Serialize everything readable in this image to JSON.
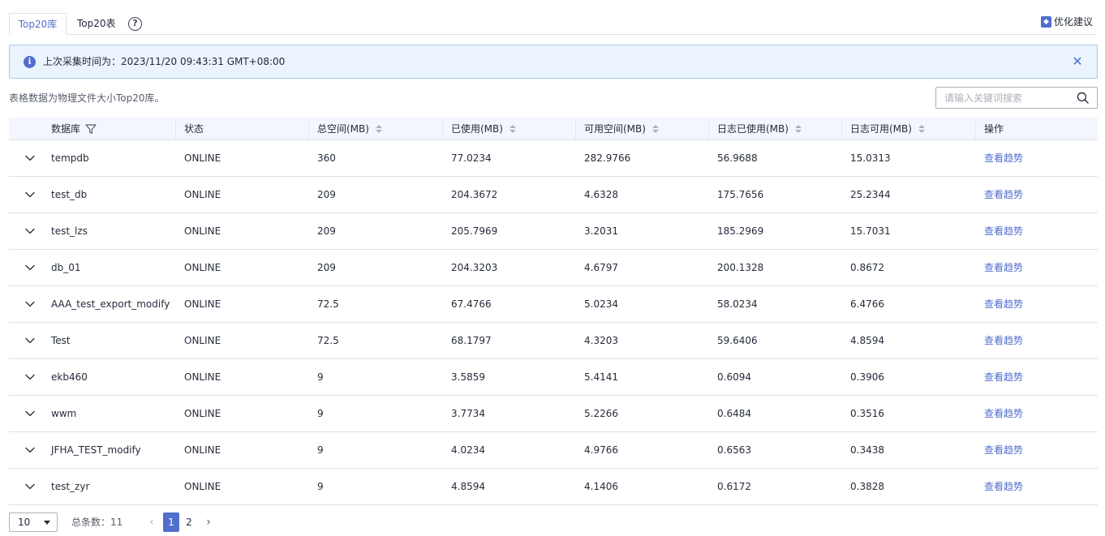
{
  "tabs": [
    {
      "label": "Top20库",
      "active": true
    },
    {
      "label": "Top20表",
      "active": false
    }
  ],
  "header": {
    "help_icon": "question-circle-icon",
    "optimize_label": "优化建议",
    "optimize_icon": "optimize-badge-icon"
  },
  "infobar": {
    "text": "上次采集时间为：2023/11/20 09:43:31 GMT+08:00",
    "icon": "info-icon",
    "close_icon": "close-icon"
  },
  "caption": "表格数据为物理文件大小Top20库。",
  "search": {
    "placeholder": "请输入关键词搜索",
    "value": ""
  },
  "table": {
    "columns": [
      "数据库",
      "状态",
      "总空间(MB)",
      "已使用(MB)",
      "可用空间(MB)",
      "日志已使用(MB)",
      "日志可用(MB)",
      "操作"
    ],
    "rows": [
      {
        "name": "tempdb",
        "status": "ONLINE",
        "total": "360",
        "used": "77.0234",
        "free": "282.9766",
        "log_used": "56.9688",
        "log_free": "15.0313",
        "action": "查看趋势"
      },
      {
        "name": "test_db",
        "status": "ONLINE",
        "total": "209",
        "used": "204.3672",
        "free": "4.6328",
        "log_used": "175.7656",
        "log_free": "25.2344",
        "action": "查看趋势"
      },
      {
        "name": "test_lzs",
        "status": "ONLINE",
        "total": "209",
        "used": "205.7969",
        "free": "3.2031",
        "log_used": "185.2969",
        "log_free": "15.7031",
        "action": "查看趋势"
      },
      {
        "name": "db_01",
        "status": "ONLINE",
        "total": "209",
        "used": "204.3203",
        "free": "4.6797",
        "log_used": "200.1328",
        "log_free": "0.8672",
        "action": "查看趋势"
      },
      {
        "name": "AAA_test_export_modify",
        "status": "ONLINE",
        "total": "72.5",
        "used": "67.4766",
        "free": "5.0234",
        "log_used": "58.0234",
        "log_free": "6.4766",
        "action": "查看趋势"
      },
      {
        "name": "Test",
        "status": "ONLINE",
        "total": "72.5",
        "used": "68.1797",
        "free": "4.3203",
        "log_used": "59.6406",
        "log_free": "4.8594",
        "action": "查看趋势"
      },
      {
        "name": "ekb460",
        "status": "ONLINE",
        "total": "9",
        "used": "3.5859",
        "free": "5.4141",
        "log_used": "0.6094",
        "log_free": "0.3906",
        "action": "查看趋势"
      },
      {
        "name": "wwm",
        "status": "ONLINE",
        "total": "9",
        "used": "3.7734",
        "free": "5.2266",
        "log_used": "0.6484",
        "log_free": "0.3516",
        "action": "查看趋势"
      },
      {
        "name": "JFHA_TEST_modify",
        "status": "ONLINE",
        "total": "9",
        "used": "4.0234",
        "free": "4.9766",
        "log_used": "0.6563",
        "log_free": "0.3438",
        "action": "查看趋势"
      },
      {
        "name": "test_zyr",
        "status": "ONLINE",
        "total": "9",
        "used": "4.8594",
        "free": "4.1406",
        "log_used": "0.6172",
        "log_free": "0.3828",
        "action": "查看趋势"
      }
    ]
  },
  "pagination": {
    "page_size": "10",
    "total_label": "总条数：11",
    "pages": [
      "1",
      "2"
    ],
    "current_page": "1"
  },
  "colors": {
    "accent": "#526ecc",
    "info_bg": "#ebf3fd",
    "info_border": "#a9c8ef",
    "header_bg": "#f3f6fd",
    "border": "#dfe1e6"
  }
}
